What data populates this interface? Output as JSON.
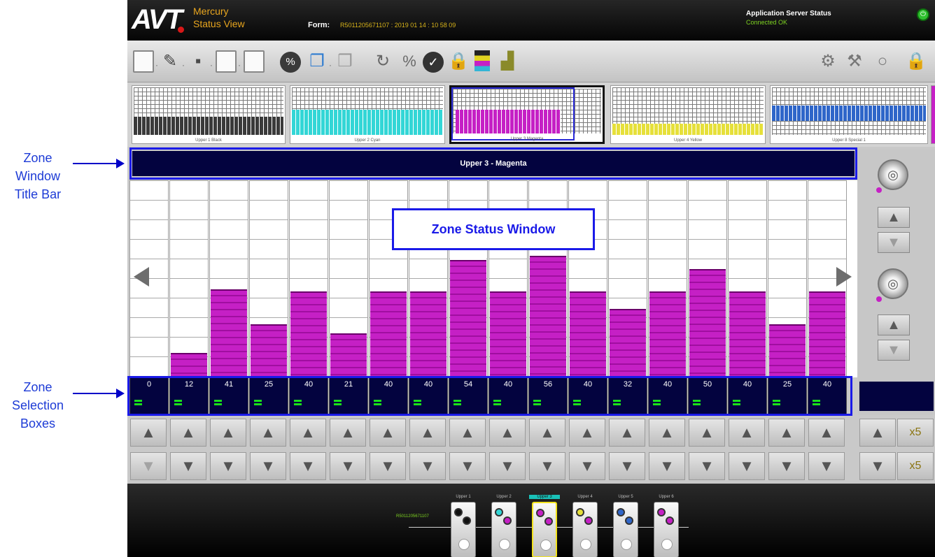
{
  "annotations": {
    "title_bar": [
      "Zone",
      "Window",
      "Title Bar"
    ],
    "selection_boxes": [
      "Zone",
      "Selection",
      "Boxes"
    ],
    "status_window": "Zone Status Window"
  },
  "header": {
    "logo": "AVT",
    "app_name": "Mercury",
    "app_sub": "Status View",
    "form_label": "Form:",
    "form_value": "R5011205671107 : 2019 01 14 : 10 58 09",
    "server_label": "Application Server Status",
    "server_value": "Connected OK",
    "power_icon": "power-icon"
  },
  "toolbar": {
    "icons": [
      "new-document-icon",
      "edit-icon",
      "save-icon",
      "export-icon",
      "form-icon",
      "percent-icon",
      "copy-icon",
      "paste-icon",
      "refresh-icon",
      "percent-scale-icon",
      "check-icon",
      "lock-icon",
      "color-bars-icon",
      "chart-icon"
    ],
    "right_icons": [
      "press-icon",
      "tool-icon",
      "ink-icon",
      "lock-right-icon"
    ]
  },
  "thumbnails": [
    {
      "label": "Upper 1 Black",
      "color": "#3a3a3a"
    },
    {
      "label": "Upper 2 Cyan",
      "color": "#33d6d6"
    },
    {
      "label": "Upper 3 Magenta",
      "color": "#c520c5"
    },
    {
      "label": "Upper 4 Yellow",
      "color": "#e6e03a"
    },
    {
      "label": "Upper 8 Special 1",
      "color": "#2f66c9"
    }
  ],
  "zone_window": {
    "title": "Upper 3 - Magenta",
    "max_value": 100,
    "values": [
      0,
      12,
      41,
      25,
      40,
      21,
      40,
      40,
      54,
      40,
      56,
      40,
      32,
      40,
      50,
      40,
      25,
      40
    ]
  },
  "zones": {
    "values": [
      "0",
      "12",
      "41",
      "25",
      "40",
      "21",
      "40",
      "40",
      "54",
      "40",
      "56",
      "40",
      "32",
      "40",
      "50",
      "40",
      "25",
      "40"
    ]
  },
  "controls": {
    "up_arrow": "▲",
    "down_arrow": "▼",
    "x5_label": "x5"
  },
  "units": {
    "form_id": "R5011205671107",
    "items": [
      {
        "name": "Upper 1",
        "c1": "#111111",
        "c2": "#111111"
      },
      {
        "name": "Upper 2",
        "c1": "#33d6d6",
        "c2": "#c520c5"
      },
      {
        "name": "Upper 3",
        "c1": "#c520c5",
        "c2": "#c520c5"
      },
      {
        "name": "Upper 4",
        "c1": "#e6e03a",
        "c2": "#c520c5"
      },
      {
        "name": "Upper 5",
        "c1": "#2f66c9",
        "c2": "#2f66c9"
      },
      {
        "name": "Upper 6",
        "c1": "#c520c5",
        "c2": "#c520c5"
      }
    ]
  }
}
